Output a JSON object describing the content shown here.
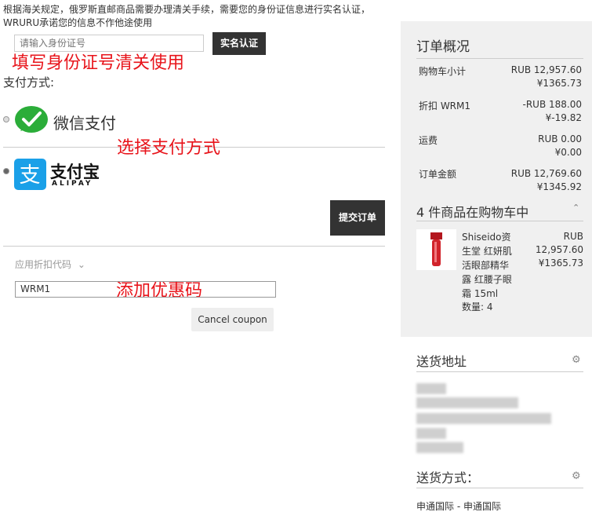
{
  "notice": {
    "line1": "根据海关规定，俄罗斯直邮商品需要办理清关手续，需要您的身份证信息进行实名认证，",
    "line2": "WRURU承诺您的信息不作他途使用"
  },
  "id_verification": {
    "placeholder": "请输入身份证号",
    "button": "实名认证"
  },
  "annotations": {
    "id": "填写身份证号清关使用",
    "payment": "选择支付方式",
    "coupon": "添加优惠码"
  },
  "payment": {
    "title": "支付方式:",
    "wechat_label": "微信支付",
    "alipay_name": "支付宝",
    "alipay_sub": "ALIPAY",
    "submit": "提交订单"
  },
  "discount": {
    "toggle": "应用折扣代码",
    "code": "WRM1",
    "cancel": "Cancel coupon"
  },
  "summary": {
    "title": "订单概况",
    "rows": [
      {
        "label": "购物车小计",
        "rub": "RUB 12,957.60",
        "cny": "¥1365.73"
      },
      {
        "label": "折扣 WRM1",
        "rub": "-RUB 188.00",
        "cny": "¥-19.82"
      },
      {
        "label": "运费",
        "rub": "RUB 0.00",
        "cny": "¥0.00"
      },
      {
        "label": "订单金额",
        "rub": "RUB 12,769.60",
        "cny": "¥1345.92"
      }
    ],
    "cart_title": "4 件商品在购物车中",
    "product": {
      "name": "Shiseido资生堂 红妍肌活眼部精华露 红腰子眼霜 15ml",
      "rub": "RUB 12,957.60",
      "cny": "¥1365.73",
      "qty": "数量: 4"
    }
  },
  "shipping_address": {
    "title": "送货地址"
  },
  "shipping_method": {
    "title": "送货方式：",
    "value": "申通国际 - 申通国际"
  }
}
